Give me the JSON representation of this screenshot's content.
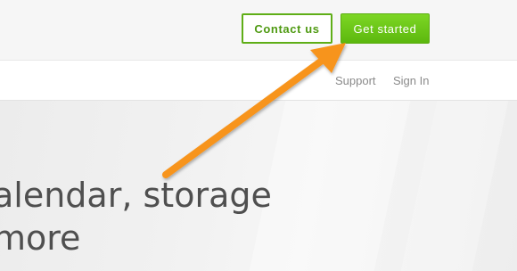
{
  "header": {
    "contact_label": "Contact us",
    "get_started_label": "Get started"
  },
  "nav": {
    "support_label": "Support",
    "signin_label": "Sign In"
  },
  "hero": {
    "line1": "alendar, storage",
    "line2": "more"
  },
  "colors": {
    "accent_green": "#5cb80e",
    "arrow_orange": "#f7941d"
  }
}
